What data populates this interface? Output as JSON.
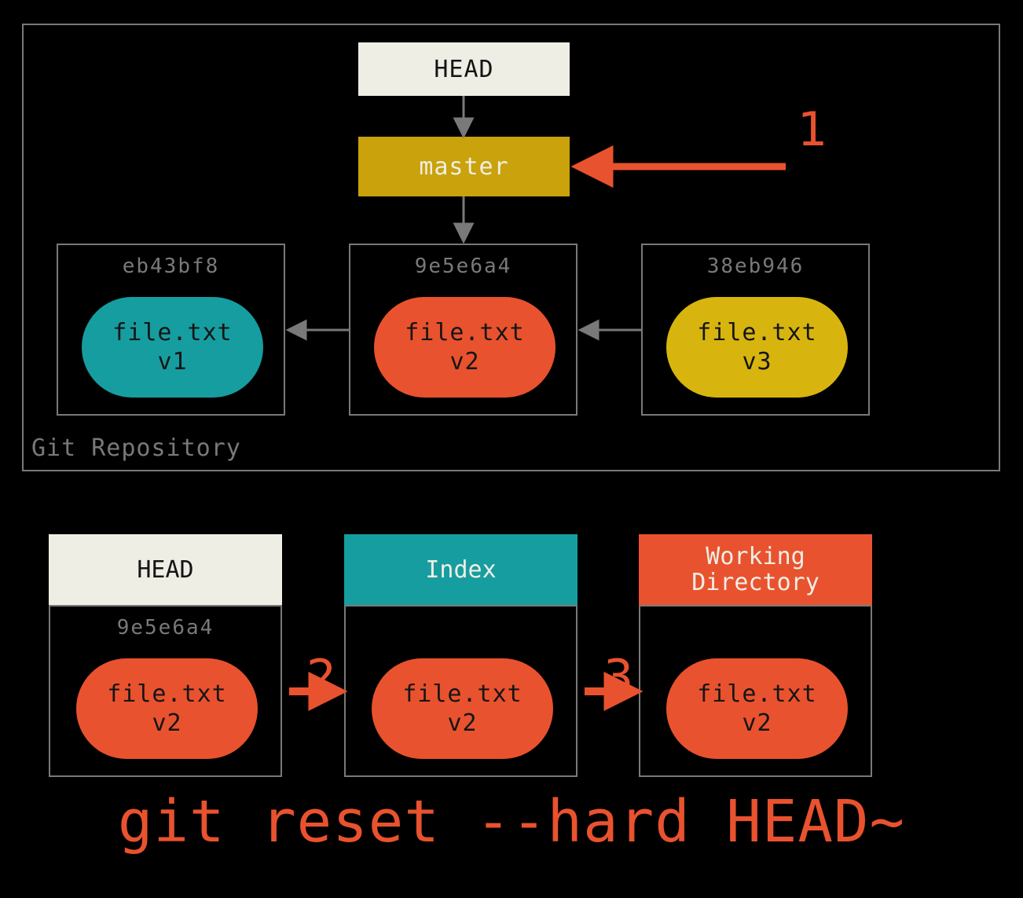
{
  "repo_label": "Git Repository",
  "head": {
    "label": "HEAD"
  },
  "branch": {
    "label": "master"
  },
  "commits": [
    {
      "hash": "eb43bf8",
      "file": "file.txt",
      "version": "v1",
      "color": "#169da0"
    },
    {
      "hash": "9e5e6a4",
      "file": "file.txt",
      "version": "v2",
      "color": "#e9522e"
    },
    {
      "hash": "38eb946",
      "file": "file.txt",
      "version": "v3",
      "color": "#d8b50e"
    }
  ],
  "panels": [
    {
      "title": "HEAD",
      "header_bg": "#efeee5",
      "header_fg": "#151515",
      "hash": "9e5e6a4",
      "file": "file.txt",
      "version": "v2",
      "pill_color": "#e9522e"
    },
    {
      "title": "Index",
      "header_bg": "#169da0",
      "header_fg": "#efeee5",
      "hash": "",
      "file": "file.txt",
      "version": "v2",
      "pill_color": "#e9522e"
    },
    {
      "title": "Working\nDirectory",
      "header_bg": "#e9522e",
      "header_fg": "#efeee5",
      "hash": "",
      "file": "file.txt",
      "version": "v2",
      "pill_color": "#e9522e"
    }
  ],
  "steps": {
    "one": "1",
    "two": "2",
    "three": "3"
  },
  "command": "git reset --hard HEAD~"
}
